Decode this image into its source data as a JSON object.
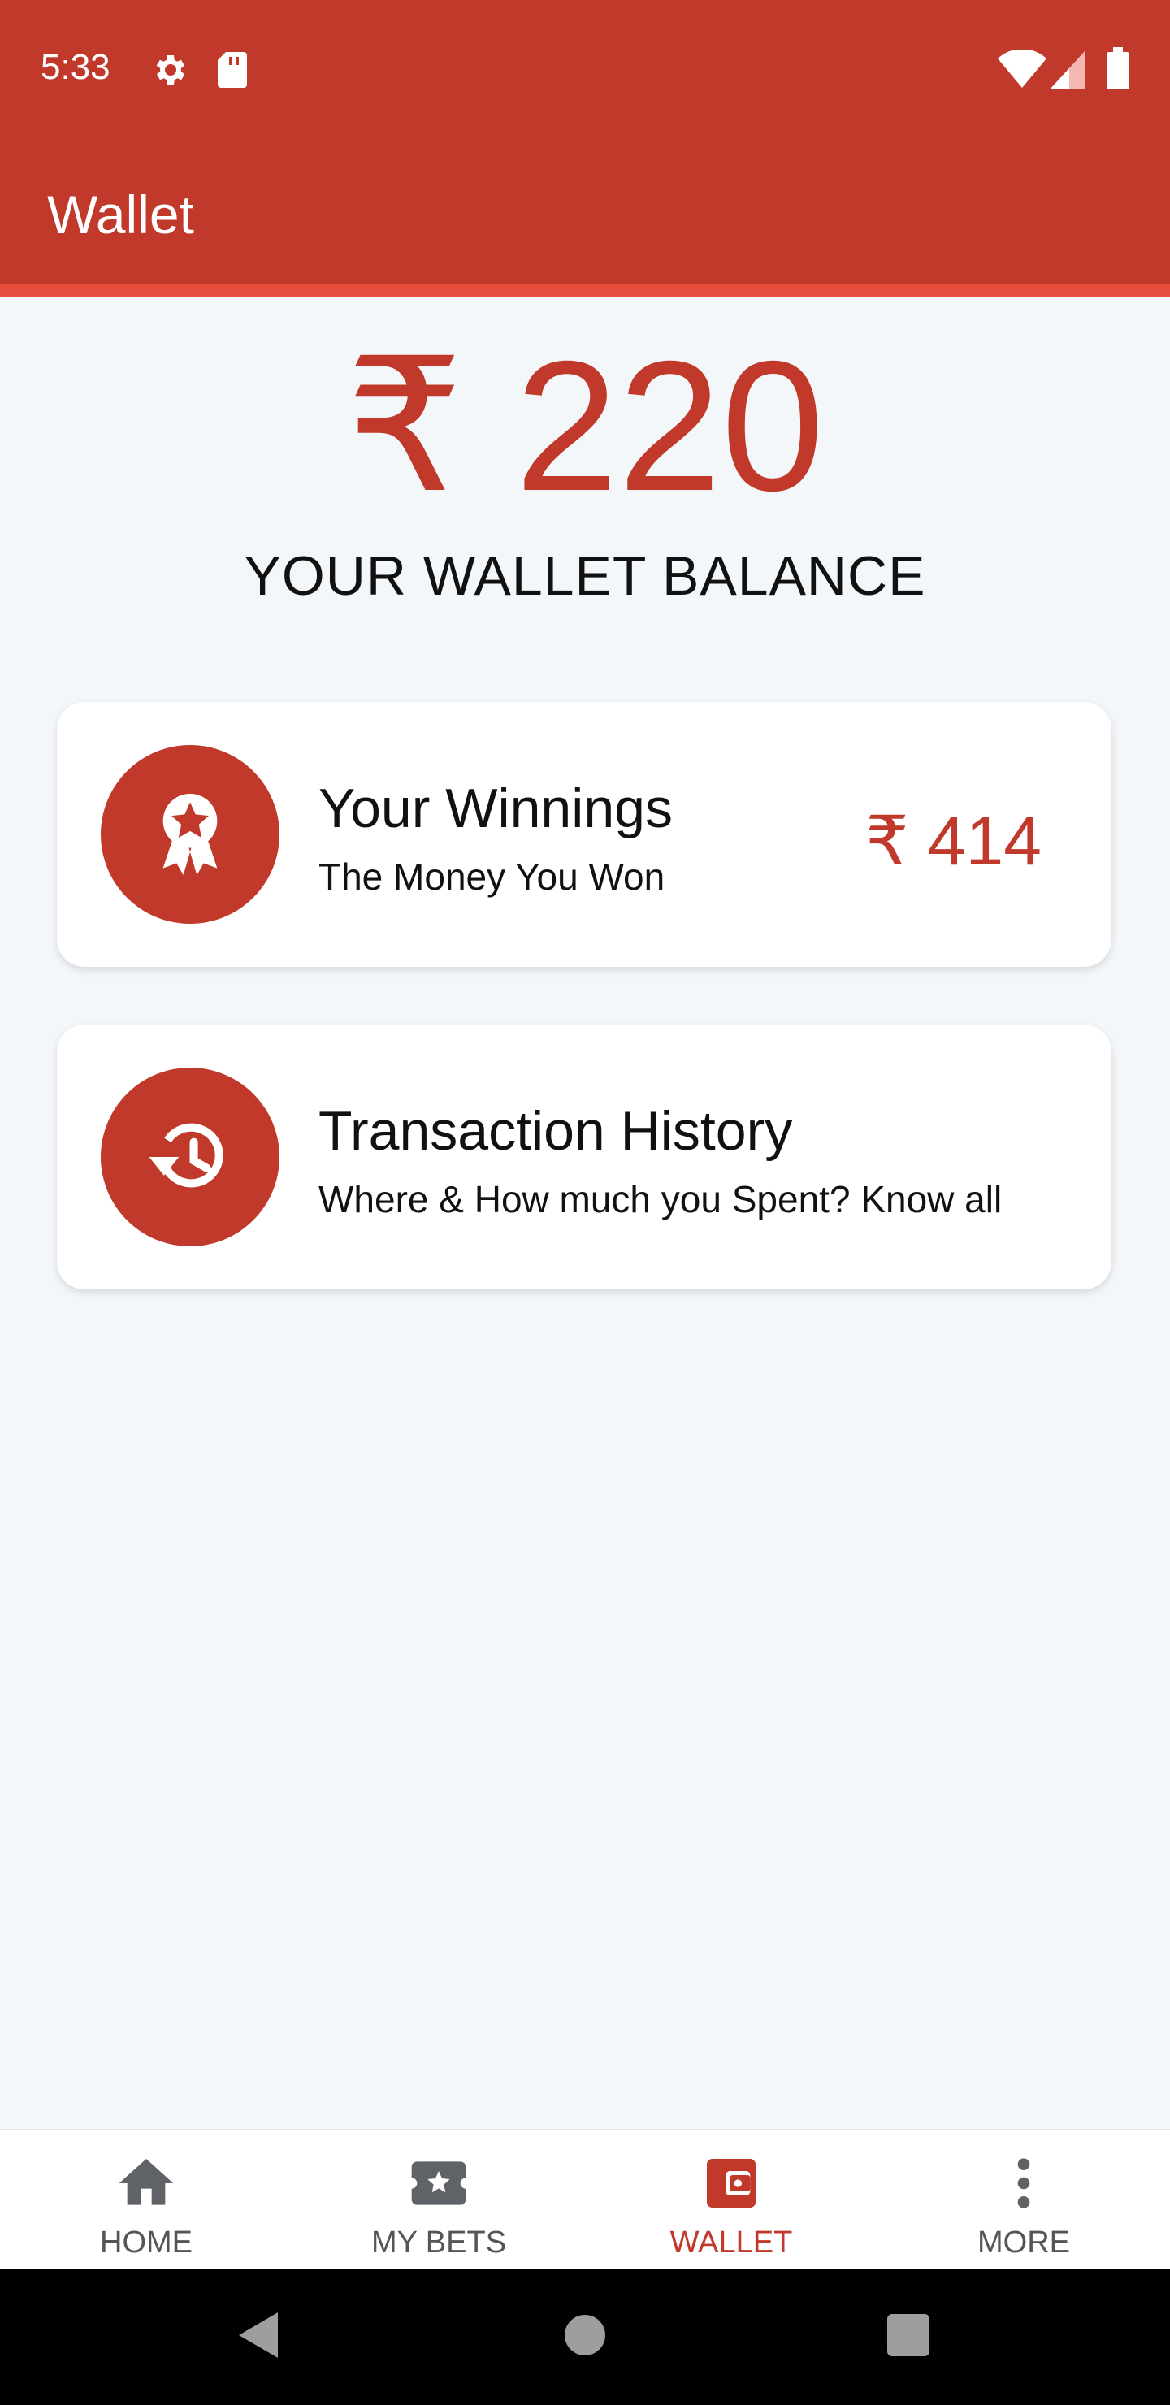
{
  "status_bar": {
    "time": "5:33",
    "icons": [
      "gear-icon",
      "sd-card-icon",
      "wifi-icon",
      "signal-icon",
      "battery-icon"
    ]
  },
  "app_bar": {
    "title": "Wallet"
  },
  "balance": {
    "amount": "₹ 220",
    "label": "YOUR WALLET BALANCE"
  },
  "cards": [
    {
      "icon": "award-ribbon-icon",
      "title": "Your Winnings",
      "subtitle": "The Money You Won",
      "amount": "₹ 414"
    },
    {
      "icon": "history-icon",
      "title": "Transaction History",
      "subtitle": "Where & How much you Spent? Know all"
    }
  ],
  "bottom_nav": {
    "items": [
      {
        "label": "HOME",
        "icon": "home-icon"
      },
      {
        "label": "MY BETS",
        "icon": "ticket-icon"
      },
      {
        "label": "WALLET",
        "icon": "wallet-icon"
      },
      {
        "label": "MORE",
        "icon": "more-vertical-icon"
      }
    ],
    "active": "WALLET"
  },
  "colors": {
    "primary": "#c0392b",
    "accent": "#e74c3c",
    "background": "#f3f7fa"
  }
}
